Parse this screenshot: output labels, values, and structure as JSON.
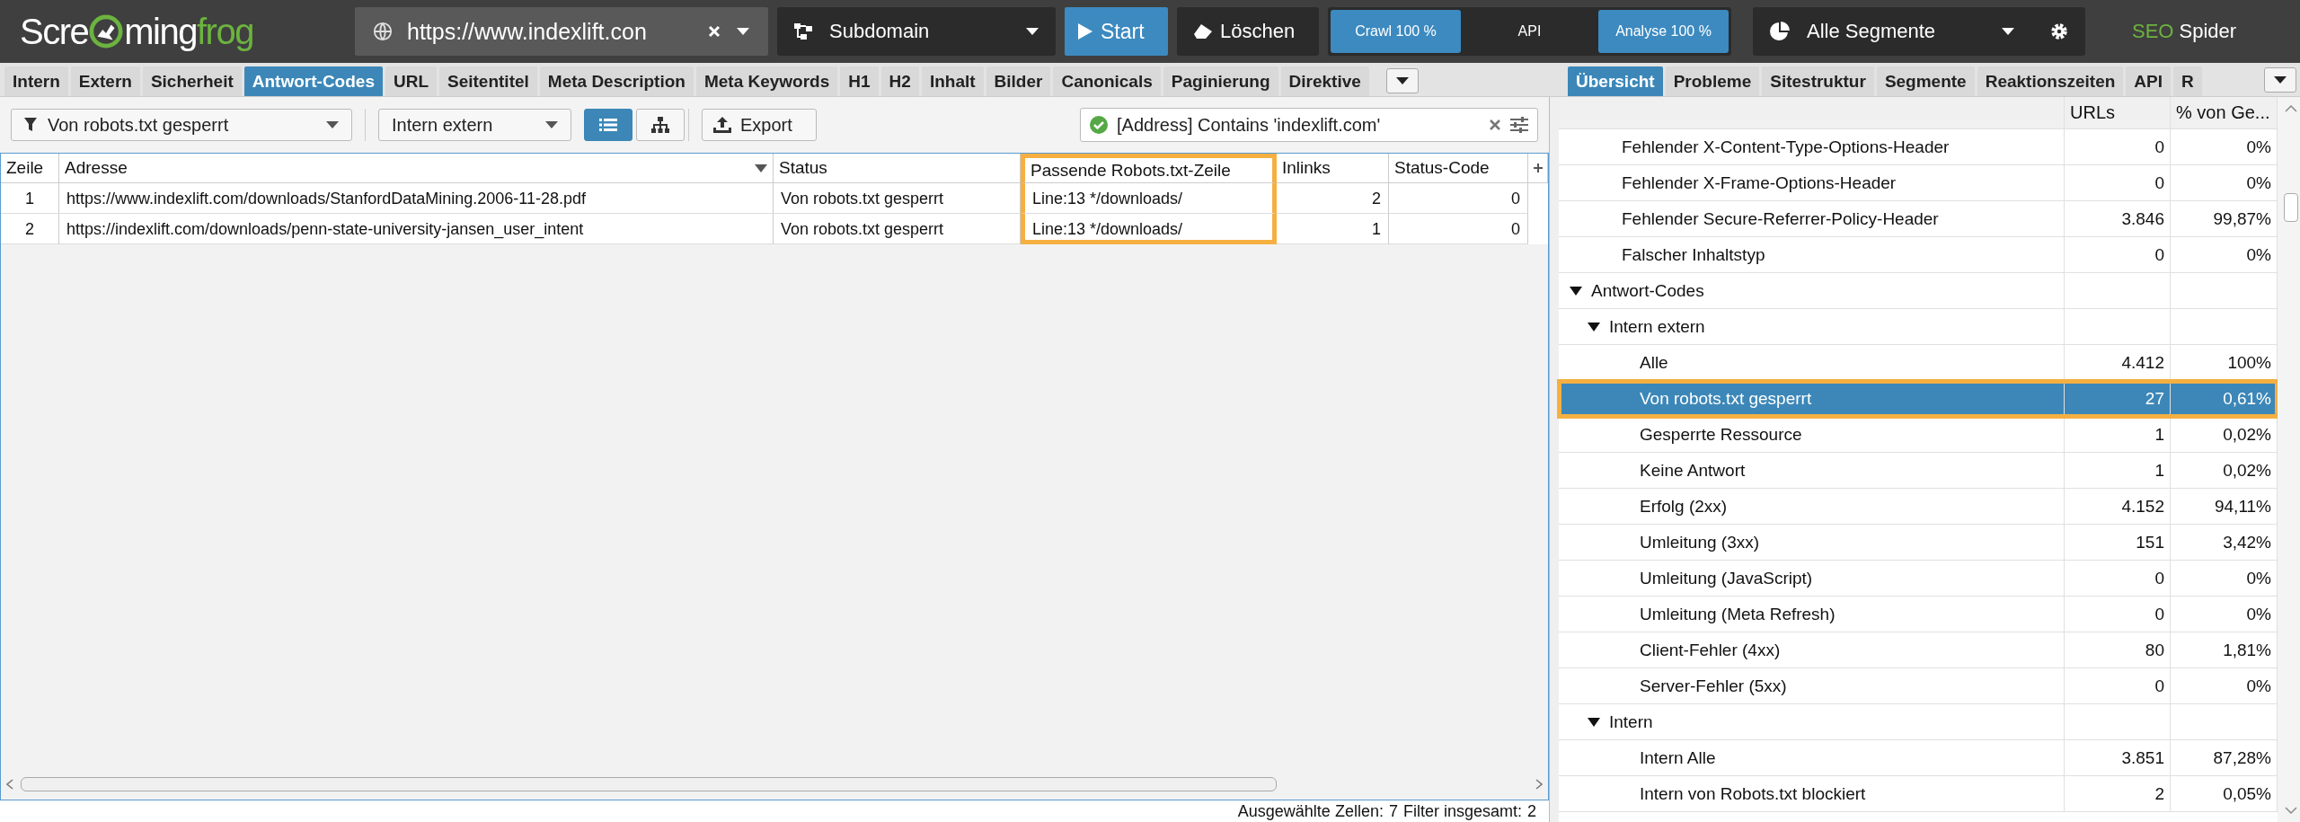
{
  "topbar": {
    "logo": {
      "start": "Scre",
      "middle": "ming",
      "end": "frog"
    },
    "url": "https://www.indexlift.con",
    "mode": "Subdomain",
    "start": "Start",
    "clear": "Löschen",
    "progress": [
      {
        "label": "Crawl 100 %",
        "active": true
      },
      {
        "label": "API",
        "active": false
      },
      {
        "label": "Analyse 100 %",
        "active": true
      }
    ],
    "segments": "Alle Segmente",
    "brand": {
      "accent": "SEO",
      "name": "Spider"
    }
  },
  "tabs": [
    {
      "label": "Intern",
      "selected": false
    },
    {
      "label": "Extern",
      "selected": false
    },
    {
      "label": "Sicherheit",
      "selected": false
    },
    {
      "label": "Antwort-Codes",
      "selected": true
    },
    {
      "label": "URL",
      "selected": false
    },
    {
      "label": "Seitentitel",
      "selected": false
    },
    {
      "label": "Meta Description",
      "selected": false
    },
    {
      "label": "Meta Keywords",
      "selected": false
    },
    {
      "label": "H1",
      "selected": false
    },
    {
      "label": "H2",
      "selected": false
    },
    {
      "label": "Inhalt",
      "selected": false
    },
    {
      "label": "Bilder",
      "selected": false
    },
    {
      "label": "Canonicals",
      "selected": false
    },
    {
      "label": "Paginierung",
      "selected": false
    },
    {
      "label": "Direktive",
      "selected": false
    }
  ],
  "right_tabs": [
    {
      "label": "Übersicht",
      "selected": true
    },
    {
      "label": "Probleme",
      "selected": false
    },
    {
      "label": "Sitestruktur",
      "selected": false
    },
    {
      "label": "Segmente",
      "selected": false
    },
    {
      "label": "Reaktionszeiten",
      "selected": false
    },
    {
      "label": "API",
      "selected": false
    },
    {
      "label": "R",
      "selected": false
    }
  ],
  "filter_bar": {
    "filter": "Von robots.txt gesperrt",
    "scope": "Intern extern",
    "views": [
      {
        "kind": "list",
        "selected": true
      },
      {
        "kind": "tree",
        "selected": false
      }
    ],
    "export": "Export",
    "search": {
      "value": "[Address] Contains 'indexlift.com'"
    }
  },
  "table": {
    "columns": [
      {
        "label": "Zeile",
        "outlined": false
      },
      {
        "label": "Adresse",
        "outlined": false
      },
      {
        "label": "Status",
        "outlined": false
      },
      {
        "label": "Passende Robots.txt-Zeile",
        "outlined": true
      },
      {
        "label": "Inlinks",
        "outlined": false
      },
      {
        "label": "Status-Code",
        "outlined": false
      }
    ],
    "rows": [
      [
        "1",
        "https://www.indexlift.com/downloads/StanfordDataMining.2006-11-28.pdf",
        "Von robots.txt gesperrt",
        "Line:13 */downloads/",
        "2",
        "0"
      ],
      [
        "2",
        "https://indexlift.com/downloads/penn-state-university-jansen_user_intent",
        "Von robots.txt gesperrt",
        "Line:13 */downloads/",
        "1",
        "0"
      ]
    ]
  },
  "status_bar": {
    "selected_label": "Ausgewählte Zellen:",
    "selected": "7",
    "total_label": "Filter insgesamt:",
    "total": "2"
  },
  "overview": {
    "columns": [
      "URLs",
      "% von Ge..."
    ],
    "continued_items": [
      {
        "label": "Fehlender X-Content-Type-Options-Header",
        "urls": "0",
        "percent": "0%",
        "selected": false,
        "outlined": false
      },
      {
        "label": "Fehlender X-Frame-Options-Header",
        "urls": "0",
        "percent": "0%",
        "selected": false,
        "outlined": false
      },
      {
        "label": "Fehlender Secure-Referrer-Policy-Header",
        "urls": "3.846",
        "percent": "99,87%",
        "selected": false,
        "outlined": false
      },
      {
        "label": "Falscher Inhaltstyp",
        "urls": "0",
        "percent": "0%",
        "selected": false,
        "outlined": false
      }
    ],
    "items": [
      {
        "label": "Antwort-Codes",
        "expanded": true,
        "selected": false,
        "outlined": false,
        "children": [
          {
            "label": "Intern extern",
            "expanded": true,
            "selected": false,
            "outlined": false,
            "children": [
              {
                "label": "Alle",
                "urls": "4.412",
                "percent": "100%",
                "selected": false,
                "outlined": false
              },
              {
                "label": "Von robots.txt gesperrt",
                "urls": "27",
                "percent": "0,61%",
                "selected": true,
                "outlined": true
              },
              {
                "label": "Gesperrte Ressource",
                "urls": "1",
                "percent": "0,02%",
                "selected": false,
                "outlined": false
              },
              {
                "label": "Keine Antwort",
                "urls": "1",
                "percent": "0,02%",
                "selected": false,
                "outlined": false
              },
              {
                "label": "Erfolg (2xx)",
                "urls": "4.152",
                "percent": "94,11%",
                "selected": false,
                "outlined": false
              },
              {
                "label": "Umleitung (3xx)",
                "urls": "151",
                "percent": "3,42%",
                "selected": false,
                "outlined": false
              },
              {
                "label": "Umleitung (JavaScript)",
                "urls": "0",
                "percent": "0%",
                "selected": false,
                "outlined": false
              },
              {
                "label": "Umleitung (Meta Refresh)",
                "urls": "0",
                "percent": "0%",
                "selected": false,
                "outlined": false
              },
              {
                "label": "Client-Fehler (4xx)",
                "urls": "80",
                "percent": "1,81%",
                "selected": false,
                "outlined": false
              },
              {
                "label": "Server-Fehler (5xx)",
                "urls": "0",
                "percent": "0%",
                "selected": false,
                "outlined": false
              }
            ]
          },
          {
            "label": "Intern",
            "expanded": true,
            "selected": false,
            "outlined": false,
            "children": [
              {
                "label": "Intern Alle",
                "urls": "3.851",
                "percent": "87,28%",
                "selected": false,
                "outlined": false
              },
              {
                "label": "Intern von Robots.txt blockiert",
                "urls": "2",
                "percent": "0,05%",
                "selected": false,
                "outlined": false
              }
            ]
          }
        ]
      }
    ]
  }
}
